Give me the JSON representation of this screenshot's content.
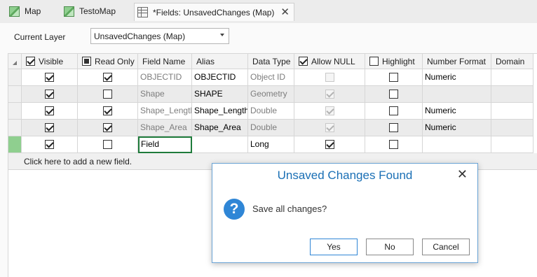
{
  "tabs": [
    {
      "label": "Map",
      "icon": "map-icon"
    },
    {
      "label": "TestoMap",
      "icon": "map-icon"
    },
    {
      "label": "*Fields:  UnsavedChanges (Map)",
      "icon": "table-icon",
      "active": true
    }
  ],
  "layer": {
    "label": "Current Layer",
    "value": "UnsavedChanges (Map)"
  },
  "columns": {
    "visible": "Visible",
    "read_only": "Read Only",
    "field_name": "Field Name",
    "alias": "Alias",
    "data_type": "Data Type",
    "allow_null": "Allow NULL",
    "highlight": "Highlight",
    "number_format": "Number Format",
    "domain": "Domain"
  },
  "rows": [
    {
      "field_name": "OBJECTID",
      "alias": "OBJECTID",
      "data_type": "Object ID",
      "number_format": "Numeric",
      "visible": true,
      "read_only": true,
      "allow_null": false,
      "allow_null_disabled": true,
      "highlight": false,
      "shaded": false
    },
    {
      "field_name": "Shape",
      "alias": "SHAPE",
      "data_type": "Geometry",
      "number_format": "",
      "visible": true,
      "read_only": false,
      "allow_null": true,
      "allow_null_disabled": true,
      "highlight": false,
      "shaded": true
    },
    {
      "field_name": "Shape_Length",
      "alias": "Shape_Length",
      "data_type": "Double",
      "number_format": "Numeric",
      "visible": true,
      "read_only": true,
      "allow_null": true,
      "allow_null_disabled": true,
      "highlight": false,
      "shaded": false
    },
    {
      "field_name": "Shape_Area",
      "alias": "Shape_Area",
      "data_type": "Double",
      "number_format": "Numeric",
      "visible": true,
      "read_only": true,
      "allow_null": true,
      "allow_null_disabled": true,
      "highlight": false,
      "shaded": true
    },
    {
      "field_name": "Field",
      "alias": "",
      "data_type": "Long",
      "number_format": "",
      "visible": true,
      "read_only": false,
      "allow_null": true,
      "allow_null_disabled": false,
      "highlight": false,
      "shaded": false,
      "current": true
    }
  ],
  "add_row_text": "Click here to add a new field.",
  "dialog": {
    "title": "Unsaved Changes Found",
    "message": "Save all changes?",
    "icon": "question-icon",
    "buttons": {
      "yes": "Yes",
      "no": "No",
      "cancel": "Cancel"
    }
  },
  "colors": {
    "accent": "#1a6fb5",
    "current_row": "#8fcf8f",
    "edit_border": "#1f7b3b"
  }
}
